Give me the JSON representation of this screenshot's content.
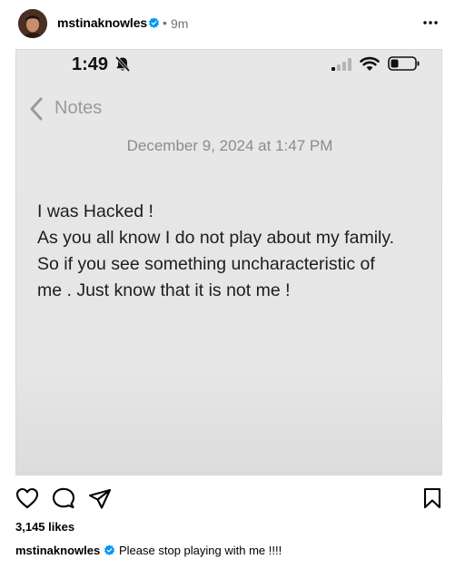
{
  "post": {
    "username": "mstinaknowles",
    "separator": "•",
    "time_ago": "9m",
    "more_icon": "more-horizontal-icon",
    "verified_icon": "verified-badge-icon"
  },
  "phone_screenshot": {
    "status_time": "1:49",
    "silent_icon": "bell-slash-icon",
    "back_label": "Notes",
    "note_date": "December 9, 2024 at 1:47 PM",
    "note_lines": [
      "I was Hacked !",
      "As you all know I do not play about my family.",
      "So if you see something uncharacteristic of",
      "me . Just know that it is not me !"
    ]
  },
  "actions": {
    "like_icon": "heart-icon",
    "comment_icon": "comment-icon",
    "share_icon": "send-icon",
    "save_icon": "bookmark-icon"
  },
  "likes": {
    "label": "3,145 likes"
  },
  "caption": {
    "username": "mstinaknowles",
    "text": "Please stop playing with me !!!!"
  },
  "colors": {
    "verified": "#0095f6",
    "muted_text": "#737373",
    "note_background": "#e6e6e6"
  }
}
